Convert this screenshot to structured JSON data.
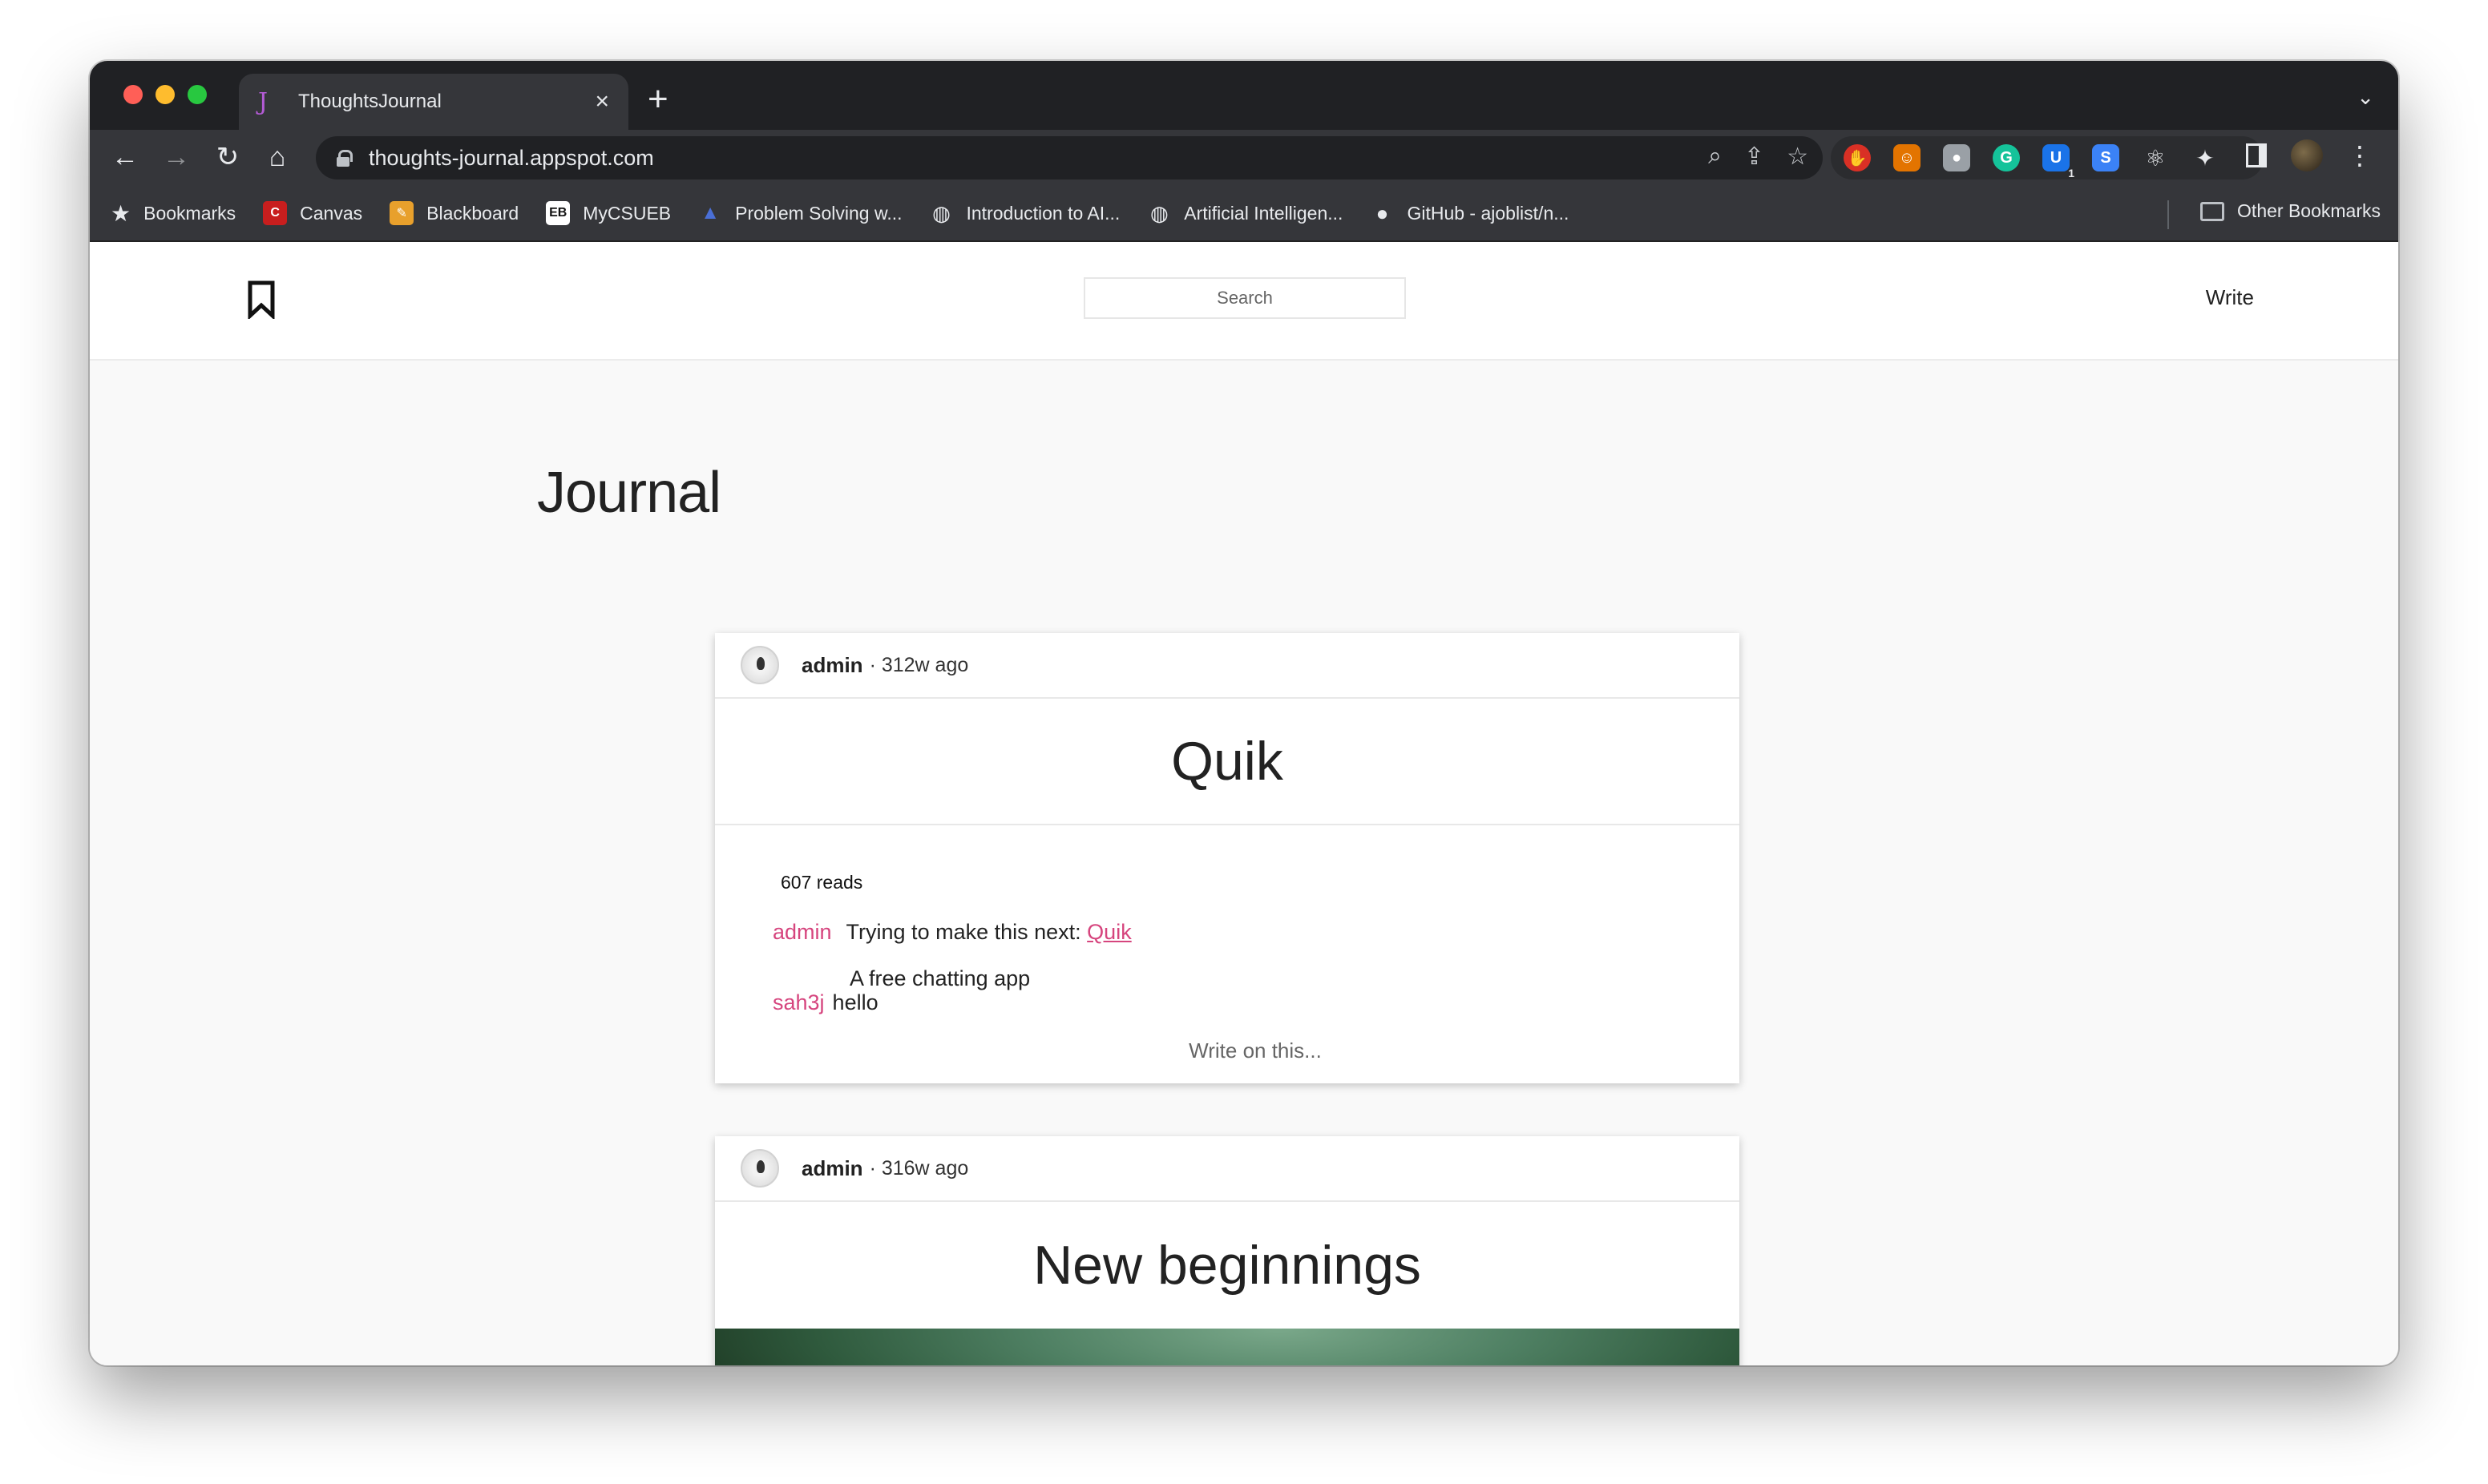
{
  "browser": {
    "tab_title": "ThoughtsJournal",
    "tab_favicon": "J",
    "new_tab": "+",
    "url": "thoughts-journal.appspot.com",
    "bookmarks": [
      {
        "label": "Bookmarks",
        "icon": "star-icon"
      },
      {
        "label": "Canvas",
        "icon": "canvas-icon",
        "color": "#c81e1e"
      },
      {
        "label": "Blackboard",
        "icon": "blackboard-icon",
        "color": "#e8a02c"
      },
      {
        "label": "MyCSUEB",
        "icon": "mycsueb-icon",
        "color": "#ffffff"
      },
      {
        "label": "Problem Solving w...",
        "icon": "triangle-icon",
        "color": "#4a6fd6"
      },
      {
        "label": "Introduction to AI...",
        "icon": "globe-icon"
      },
      {
        "label": "Artificial Intelligen...",
        "icon": "globe-icon"
      },
      {
        "label": "GitHub - ajoblist/n...",
        "icon": "github-icon"
      }
    ],
    "other_bookmarks": "Other Bookmarks",
    "extension_badge": "1"
  },
  "site": {
    "search_placeholder": "Search",
    "write_label": "Write",
    "page_title": "Journal"
  },
  "posts": [
    {
      "author": "admin",
      "time": "· 312w ago",
      "title": "Quik",
      "reads": "607 reads",
      "comments": [
        {
          "user": "admin",
          "text": "Trying to make this next: ",
          "link": "Quik",
          "extra": "A free chatting app"
        },
        {
          "user": "sah3j",
          "text": "hello"
        }
      ],
      "write_prompt": "Write on this..."
    },
    {
      "author": "admin",
      "time": "· 316w ago",
      "title": "New beginnings"
    }
  ]
}
